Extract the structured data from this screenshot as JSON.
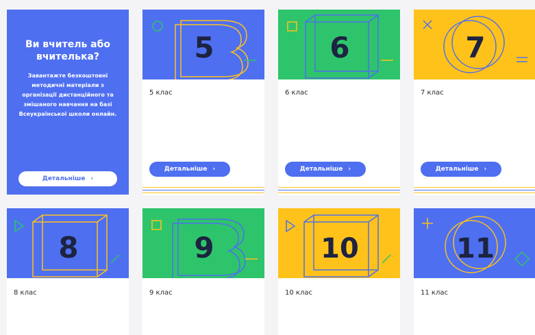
{
  "promo": {
    "title": "Ви вчитель або вчителька?",
    "text": "Завантажте безкоштовні методичні матеріали з організації дистанційного та змішаного навчання на базі Всеукраїнської школи онлайн.",
    "button": "Детальніше"
  },
  "cards": [
    {
      "number": "5",
      "label": "5 клас",
      "button": "Детальніше"
    },
    {
      "number": "6",
      "label": "6 клас",
      "button": "Детальніше"
    },
    {
      "number": "7",
      "label": "7 клас",
      "button": "Детальніше"
    },
    {
      "number": "8",
      "label": "8 клас"
    },
    {
      "number": "9",
      "label": "9 клас"
    },
    {
      "number": "10",
      "label": "10 клас"
    },
    {
      "number": "11",
      "label": "11 клас"
    }
  ],
  "icons": {
    "chevron": "chevron-right-icon",
    "chevron_glyph": "›"
  },
  "colors": {
    "blue": "#4e6ff0",
    "green": "#2ec46b",
    "yellow": "#ffc21a",
    "dark": "#1d2340"
  }
}
